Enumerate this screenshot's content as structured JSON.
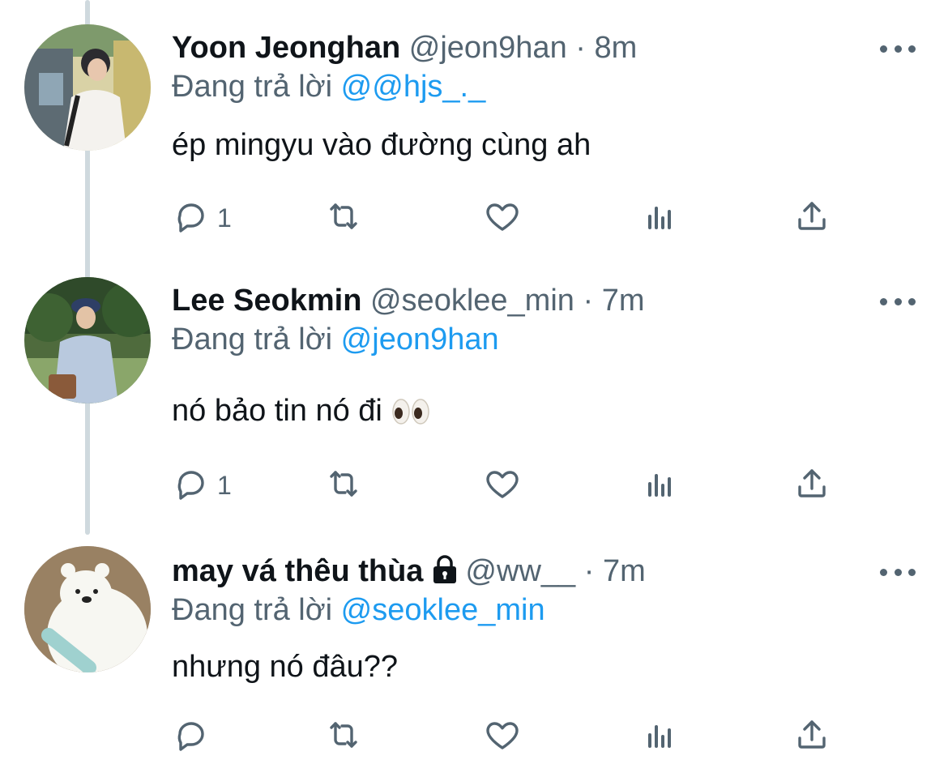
{
  "tweets": [
    {
      "name": "Yoon Jeonghan",
      "handle": "@jeon9han",
      "separator": "·",
      "time": "8m",
      "replying_prefix": "Đang trả lời",
      "replying_to": "@@hjs_._",
      "text": "ép mingyu vào đường cùng ah",
      "reply_count": "1",
      "retweet_count": "",
      "like_count": ""
    },
    {
      "name": "Lee Seokmin",
      "handle": "@seoklee_min",
      "separator": "·",
      "time": "7m",
      "replying_prefix": "Đang trả lời",
      "replying_to": "@jeon9han",
      "text": "nó bảo tin nó đi",
      "emoji": "eyes-emoji",
      "reply_count": "1",
      "retweet_count": "",
      "like_count": ""
    },
    {
      "name": "may vá thêu thùa",
      "handle": "@ww__",
      "separator": "·",
      "time": "7m",
      "replying_prefix": "Đang trả lời",
      "replying_to": "@seoklee_min",
      "text": "nhưng nó đâu??",
      "locked": true,
      "reply_count": "",
      "retweet_count": "",
      "like_count": ""
    }
  ],
  "icons": {
    "reply": "reply-icon",
    "retweet": "retweet-icon",
    "like": "heart-icon",
    "views": "analytics-icon",
    "share": "share-icon",
    "more": "more-options-icon",
    "lock": "lock-icon"
  },
  "colors": {
    "text": "#0f1419",
    "secondary": "#536471",
    "link": "#1d9bf0",
    "thread_line": "#cfd9de"
  }
}
